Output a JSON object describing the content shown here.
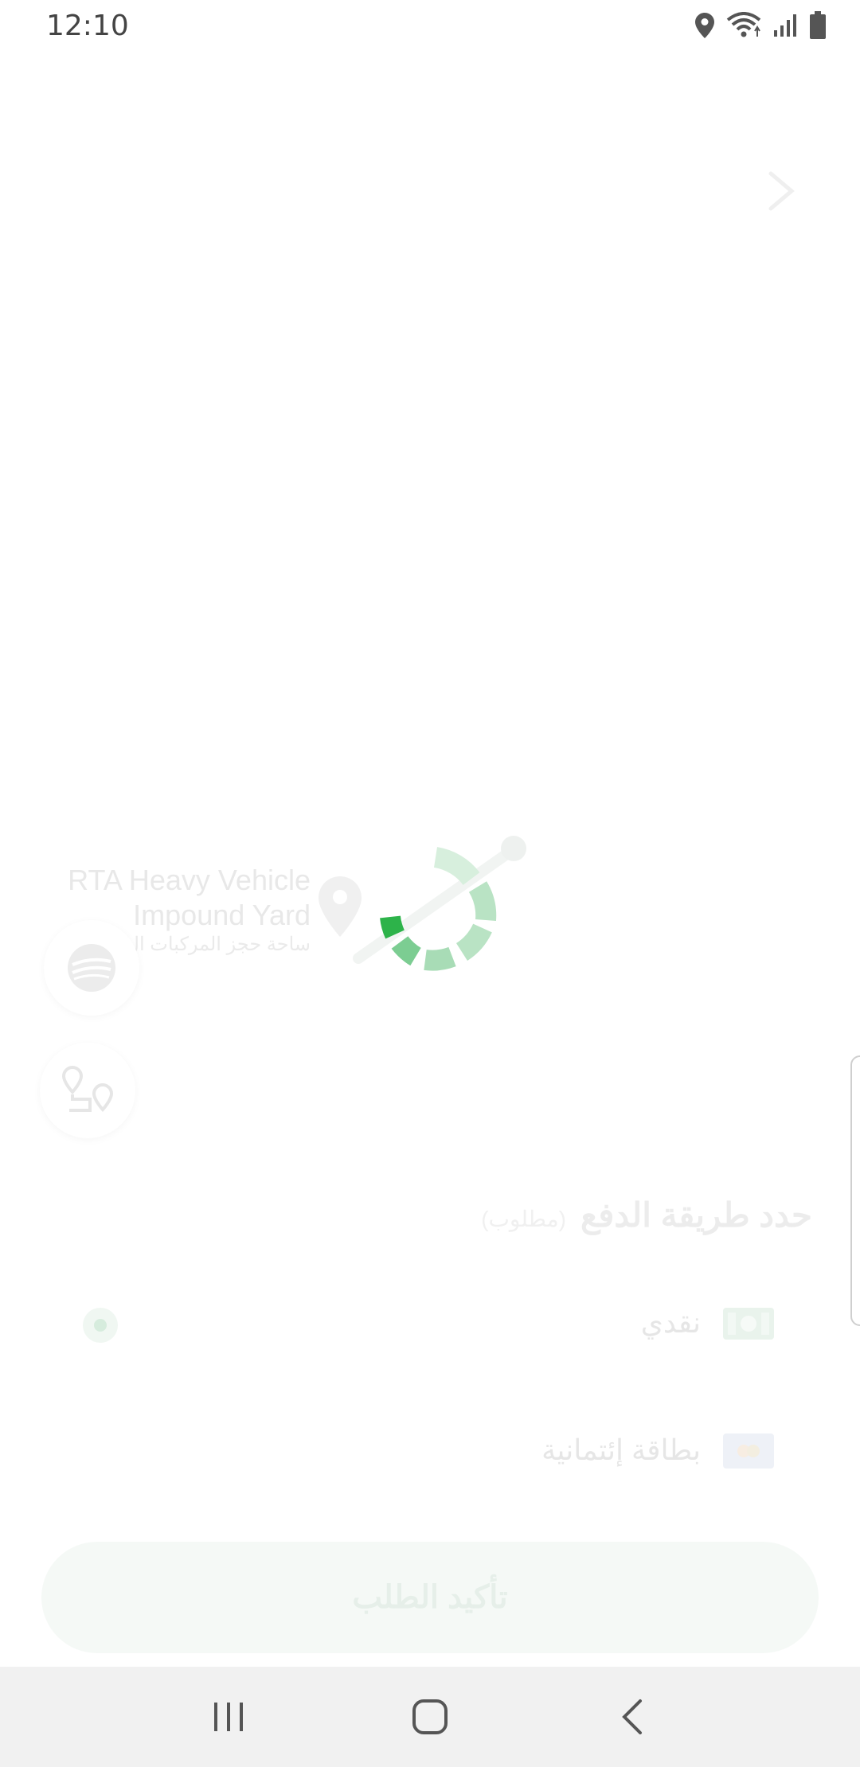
{
  "status_bar": {
    "time": "12:10",
    "icons": [
      "location-icon",
      "wifi-icon",
      "signal-icon",
      "battery-icon"
    ]
  },
  "header": {
    "back_icon": "chevron-right-icon"
  },
  "location": {
    "name_line1": "RTA Heavy Vehicle",
    "name_line2": "Impound Yard",
    "name_ar": "ساحة حجز المركبات ال"
  },
  "loading": {
    "spinner_icon": "loading-spinner-icon",
    "accent_color": "#2db34a"
  },
  "payment": {
    "title": "حدد طريقة الدفع",
    "required": "(مطلوب)",
    "options": [
      {
        "label": "نقدي",
        "icon": "cash-icon"
      },
      {
        "label": "بطاقة إئتمانية",
        "icon": "credit-card-icon"
      }
    ]
  },
  "confirm": {
    "label": "تأكيد الطلب"
  },
  "nav": {
    "recent_icon": "recent-apps-icon",
    "home_icon": "home-icon",
    "back_icon": "back-icon"
  }
}
